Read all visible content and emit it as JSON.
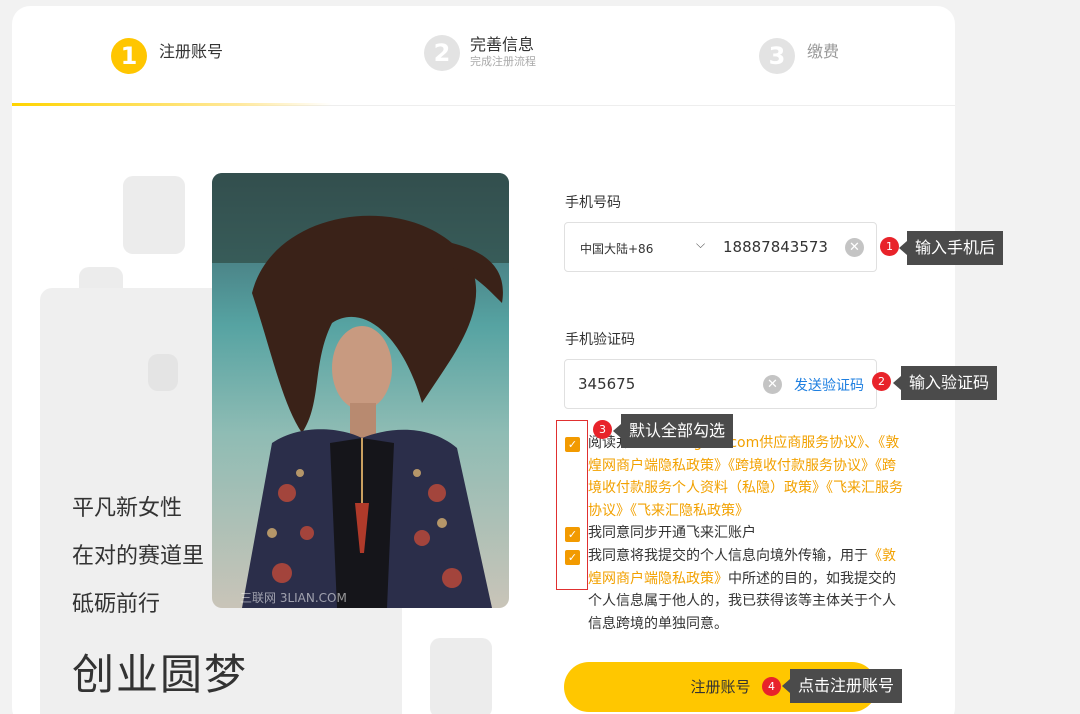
{
  "steps": [
    {
      "num": "1",
      "title": "注册账号",
      "sub": ""
    },
    {
      "num": "2",
      "title": "完善信息",
      "sub": "完成注册流程"
    },
    {
      "num": "3",
      "title": "缴费",
      "sub": ""
    }
  ],
  "left": {
    "taglines": [
      "平凡新女性",
      "在对的赛道里",
      "砥砺前行"
    ],
    "headline": "创业圆梦",
    "watermark": "三联网 3LIAN.COM"
  },
  "form": {
    "phone_label": "手机号码",
    "country": "中国大陆+86",
    "phone_value": "18887843573",
    "code_label": "手机验证码",
    "code_value": "345675",
    "send_code": "发送验证码",
    "submit": "注册账号"
  },
  "agreements": {
    "line1_prefix": "阅读并同意",
    "line1_links": "《DHgate.com供应商服务协议》、《敦煌网商户端隐私政策》《跨境收付款服务协议》《跨境收付款服务个人资料（私隐）政策》《飞来汇服务协议》《飞来汇隐私政策》",
    "line2": "我同意同步开通飞来汇账户",
    "line3_prefix": "我同意将我提交的个人信息向境外传输，用于",
    "line3_link": "《敦煌网商户端隐私政策》",
    "line3_suffix": "中所述的目的，如我提交的个人信息属于他人的，我已获得该等主体关于个人信息跨境的单独同意。"
  },
  "annotations": [
    {
      "num": "1",
      "text": "输入手机后"
    },
    {
      "num": "2",
      "text": "输入验证码"
    },
    {
      "num": "3",
      "text": "默认全部勾选"
    },
    {
      "num": "4",
      "text": "点击注册账号"
    }
  ],
  "colors": {
    "accent": "#ffc700",
    "link": "#f2a100",
    "blue_link": "#1e7fe0",
    "badge": "#e8232a"
  }
}
